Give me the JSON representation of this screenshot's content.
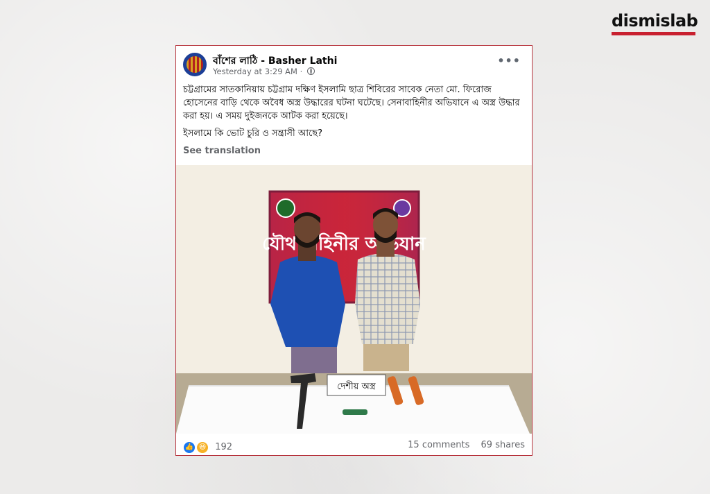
{
  "brand": {
    "logo_text": "dismislab",
    "accent_color": "#c8202f"
  },
  "post": {
    "page_name": "বাঁশের লাঠি - Basher Lathi",
    "timestamp": "Yesterday at 3:29 AM",
    "separator": "·",
    "privacy_icon": "globe-icon",
    "more_icon": "more-options-icon",
    "body_paragraph_1": "চট্টগ্রামের সাতকানিয়ায় চট্টগ্রাম দক্ষিণ ইসলামি ছাত্র শিবিরের সাবেক নেতা  মো. ফিরোজ হোসেনের বাড়ি থেকে অবৈধ অস্ত্র উদ্ধারের ঘটনা ঘটেছে। সেনাবাহিনীর অভিযানে এ অস্ত্র উদ্ধার করা হয়। এ সময় দুইজনকে আটক করা হয়েছে।",
    "body_paragraph_2": "ইসলামে কি ভোট চুরি ও সন্ত্রাসী আছে?",
    "see_translation": "See translation",
    "photo": {
      "banner_text": "যৌথ বাহিনীর অভিযান",
      "table_sign": "দেশীয় অস্ত্র"
    },
    "reaction_icons": [
      "like-icon",
      "haha-icon"
    ],
    "reaction_count": "192",
    "comments": "15 comments",
    "shares": "69 shares"
  }
}
